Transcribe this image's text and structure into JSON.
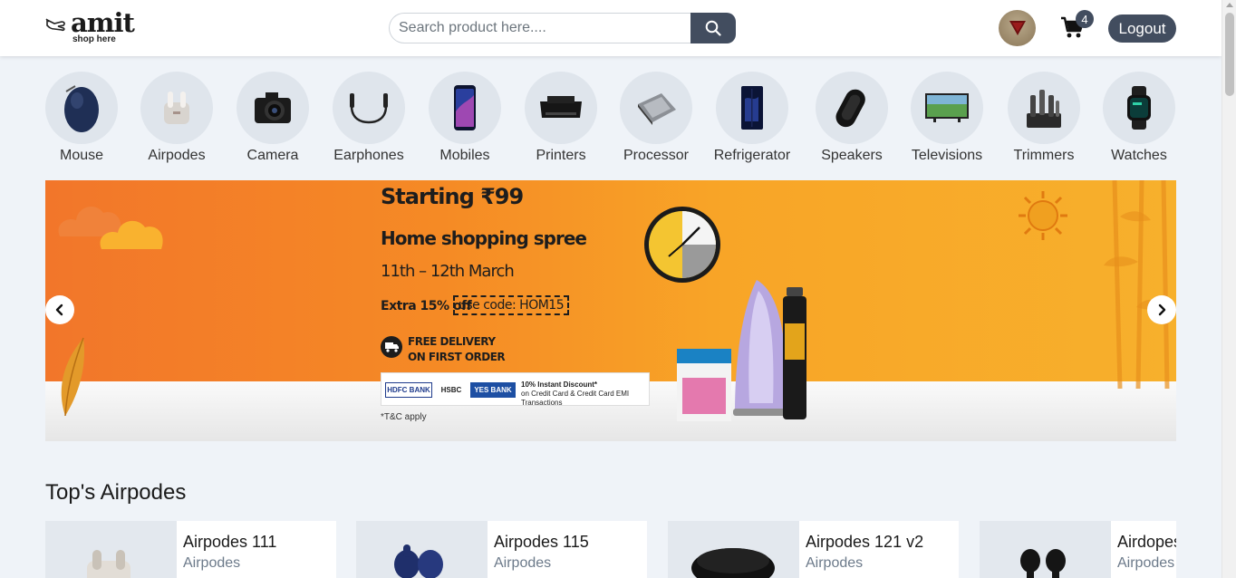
{
  "header": {
    "logo_word": "amit",
    "logo_tagline": "shop here",
    "search_placeholder": "Search product here....",
    "cart_count": "4",
    "logout_label": "Logout"
  },
  "categories": [
    {
      "label": "Mouse",
      "icon": "mouse-icon"
    },
    {
      "label": "Airpodes",
      "icon": "airpods-icon"
    },
    {
      "label": "Camera",
      "icon": "camera-icon"
    },
    {
      "label": "Earphones",
      "icon": "earphones-icon"
    },
    {
      "label": "Mobiles",
      "icon": "mobile-icon"
    },
    {
      "label": "Printers",
      "icon": "printer-icon"
    },
    {
      "label": "Processor",
      "icon": "processor-icon"
    },
    {
      "label": "Refrigerator",
      "icon": "refrigerator-icon"
    },
    {
      "label": "Speakers",
      "icon": "speaker-icon"
    },
    {
      "label": "Televisions",
      "icon": "television-icon"
    },
    {
      "label": "Trimmers",
      "icon": "trimmer-icon"
    },
    {
      "label": "Watches",
      "icon": "watch-icon"
    }
  ],
  "banner": {
    "line1": "Starting ₹99",
    "line2": "Home shopping spree",
    "line3": "11th – 12th March",
    "line4": "Extra 15% off",
    "code": "use code: HOM15",
    "delivery_line1": "FREE DELIVERY",
    "delivery_line2": "ON FIRST ORDER",
    "bank1": "HDFC BANK",
    "bank2": "HSBC",
    "bank3": "YES BANK",
    "discount_line1": "10% Instant Discount*",
    "discount_line2": "on Credit Card & Credit Card EMI Transactions",
    "tc": "*T&C apply"
  },
  "section": {
    "title": "Top's Airpodes"
  },
  "products": [
    {
      "name": "Airpodes 111",
      "category": "Airpodes"
    },
    {
      "name": "Airpodes 115",
      "category": "Airpodes"
    },
    {
      "name": "Airpodes 121 v2",
      "category": "Airpodes"
    },
    {
      "name": "Airdopes",
      "category": "Airpodes"
    }
  ],
  "colors": {
    "accent": "#424d5f",
    "background": "#eff3f8",
    "banner_orange": "#f58a25"
  }
}
